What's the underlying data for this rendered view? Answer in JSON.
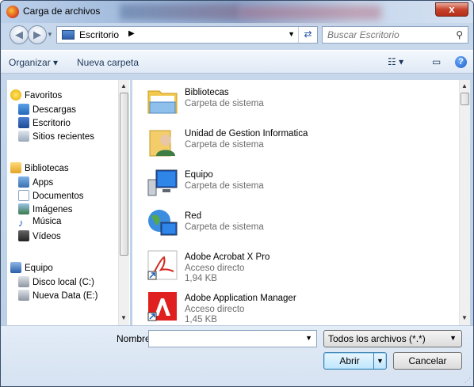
{
  "window": {
    "title": "Carga de archivos",
    "close_label": "x"
  },
  "address": {
    "location": "Escritorio",
    "search_placeholder": "Buscar Escritorio"
  },
  "toolbar": {
    "organize": "Organizar ▾",
    "new_folder": "Nueva carpeta"
  },
  "navigation": {
    "favorites": {
      "label": "Favoritos",
      "items": [
        "Descargas",
        "Escritorio",
        "Sitios recientes"
      ]
    },
    "libraries": {
      "label": "Bibliotecas",
      "items": [
        "Apps",
        "Documentos",
        "Imágenes",
        "Música",
        "Vídeos"
      ]
    },
    "computer": {
      "label": "Equipo",
      "items": [
        "Disco local (C:)",
        "Nueva Data (E:)"
      ]
    }
  },
  "files": [
    {
      "name": "Bibliotecas",
      "type": "Carpeta de sistema",
      "size": "",
      "icon": "libraries-icon"
    },
    {
      "name": "Unidad de Gestion Informatica",
      "type": "Carpeta de sistema",
      "size": "",
      "icon": "user-folder-icon"
    },
    {
      "name": "Equipo",
      "type": "Carpeta de sistema",
      "size": "",
      "icon": "computer-icon"
    },
    {
      "name": "Red",
      "type": "Carpeta de sistema",
      "size": "",
      "icon": "network-icon"
    },
    {
      "name": "Adobe Acrobat X Pro",
      "type": "Acceso directo",
      "size": "1,94 KB",
      "icon": "acrobat-icon"
    },
    {
      "name": "Adobe Application Manager",
      "type": "Acceso directo",
      "size": "1,45 KB",
      "icon": "adobe-app-manager-icon"
    }
  ],
  "bottom": {
    "filename_label": "Nombre:",
    "filename_value": "",
    "filetype_value": "Todos los archivos (*.*)",
    "open_label": "Abrir",
    "cancel_label": "Cancelar"
  }
}
